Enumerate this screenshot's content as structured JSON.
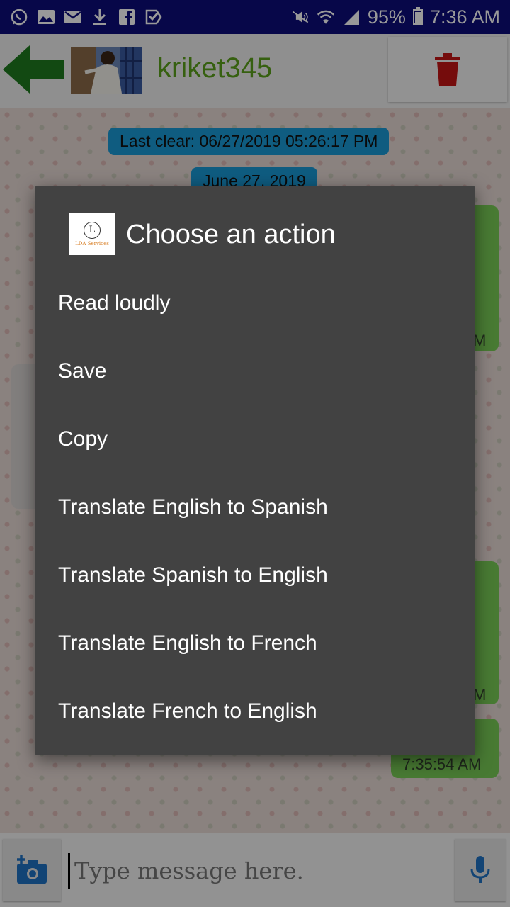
{
  "status_bar": {
    "battery": "95%",
    "time": "7:36 AM",
    "battery_level": 0.95
  },
  "header": {
    "username": "kriket345"
  },
  "chat": {
    "last_clear": "Last clear: 06/27/2019 05:26:17 PM",
    "date_label": "June 27, 2019",
    "msg_time_1": "M",
    "msg_time_2": "M",
    "msg_time_3": "7:35:54 AM"
  },
  "dialog": {
    "title": "Choose an action",
    "logo": {
      "initial": "L",
      "text": "LDA Services"
    },
    "actions": [
      "Read loudly",
      "Save",
      "Copy",
      "Translate English to Spanish",
      "Translate Spanish to English",
      "Translate English to French",
      "Translate French to English"
    ]
  },
  "input_bar": {
    "placeholder": "Type message here."
  },
  "colors": {
    "status_bar": "#0c0c7a",
    "username": "#5ba01c",
    "trash": "#c41414",
    "back_arrow": "#1e7a1e",
    "pill": "#1a9ad6",
    "bubble": "#79cc55",
    "dialog": "#424242",
    "icon_blue": "#1f72c4"
  }
}
